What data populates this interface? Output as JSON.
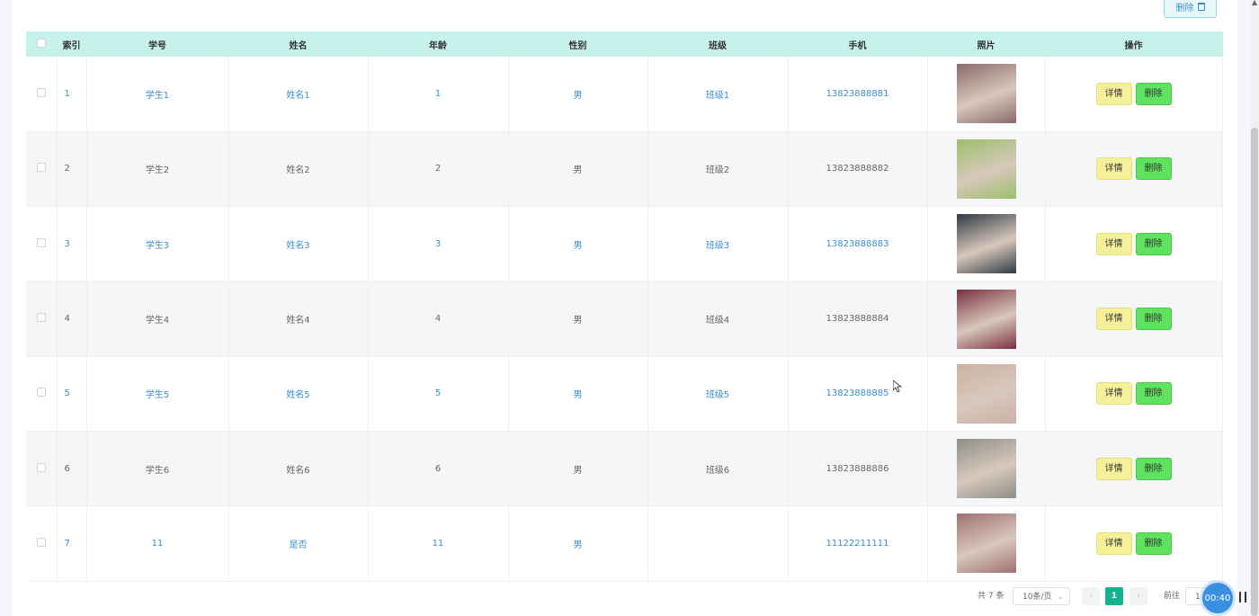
{
  "toolbar": {
    "delete_label": "删除"
  },
  "table": {
    "headers": [
      "",
      "索引",
      "学号",
      "姓名",
      "年龄",
      "性别",
      "班级",
      "手机",
      "照片",
      "操作"
    ],
    "rows": [
      {
        "index": "1",
        "student_id": "学生1",
        "name": "姓名1",
        "age": "1",
        "gender": "男",
        "class": "班级1",
        "phone": "13823888881",
        "photo_color": "#8a6a6a"
      },
      {
        "index": "2",
        "student_id": "学生2",
        "name": "姓名2",
        "age": "2",
        "gender": "男",
        "class": "班级2",
        "phone": "13823888882",
        "photo_color": "#9bbf6a"
      },
      {
        "index": "3",
        "student_id": "学生3",
        "name": "姓名3",
        "age": "3",
        "gender": "男",
        "class": "班级3",
        "phone": "13823888883",
        "photo_color": "#2f3a44"
      },
      {
        "index": "4",
        "student_id": "学生4",
        "name": "姓名4",
        "age": "4",
        "gender": "男",
        "class": "班级4",
        "phone": "13823888884",
        "photo_color": "#7a3040"
      },
      {
        "index": "5",
        "student_id": "学生5",
        "name": "姓名5",
        "age": "5",
        "gender": "男",
        "class": "班级5",
        "phone": "13823888885",
        "photo_color": "#c9b2a4"
      },
      {
        "index": "6",
        "student_id": "学生6",
        "name": "姓名6",
        "age": "6",
        "gender": "男",
        "class": "班级6",
        "phone": "13823888886",
        "photo_color": "#8e8e88"
      },
      {
        "index": "7",
        "student_id": "11",
        "name": "是否",
        "age": "11",
        "gender": "男",
        "class": "",
        "phone": "11122211111",
        "photo_color": "#a07070"
      }
    ],
    "detail_label": "详情",
    "delete_label": "删除"
  },
  "pagination": {
    "total": "共 7 条",
    "page_size": "10条/页",
    "prev": "‹",
    "current_page": "1",
    "next": "›",
    "goto_label": "前往",
    "goto_value": "1"
  },
  "timer": "00:40",
  "colors": {
    "header_bg": "#c7f2ec",
    "link": "#3a8ed0",
    "active_page": "#13b38e",
    "detail_btn": "#f5f09a",
    "delete_btn": "#5ee35e"
  }
}
